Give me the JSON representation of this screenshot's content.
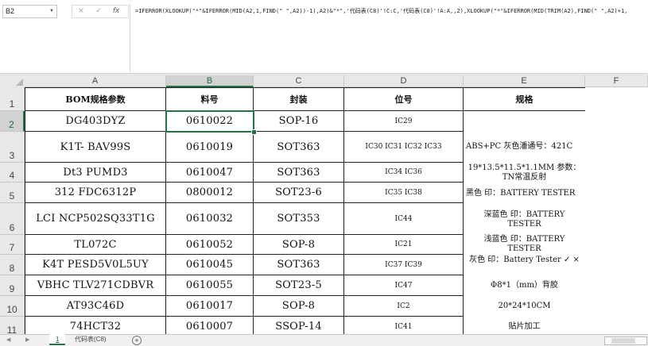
{
  "namebox": "B2",
  "formula_icons": {
    "cancel": "×",
    "confirm": "✓",
    "fx": "fx"
  },
  "formula": "=IFERROR(XLOOKUP(\"*\"&IFERROR(MID(A2,1,FIND(\" \",A2))-1),A2)&\"*\",'代码表(C8)'!C:C,'代码表(C8)'!A:A,,2),XLOOKUP(\"*\"&IFERROR(MID(TRIM(A2),FIND(\" \",A2)+1,",
  "columns": [
    "A",
    "B",
    "C",
    "D",
    "E",
    "F"
  ],
  "rows": [
    "1",
    "2",
    "3",
    "4",
    "5",
    "6",
    "7",
    "8",
    "9",
    "10",
    "11"
  ],
  "header": {
    "bom": "BOM规格参数",
    "part": "料号",
    "package": "封装",
    "position": "位号",
    "spec": "规格"
  },
  "data": [
    {
      "bom": "DG403DYZ",
      "part": "0610022",
      "package": "SOP-16",
      "position": "IC29"
    },
    {
      "bom": "K1T- BAV99S",
      "part": "0610019",
      "package": "SOT363",
      "position": "IC30 IC31 IC32 IC33"
    },
    {
      "bom": "Dt3  PUMD3",
      "part": "0610047",
      "package": "SOT363",
      "position": "IC34 IC36"
    },
    {
      "bom": "312  FDC6312P",
      "part": "0800012",
      "package": "SOT23-6",
      "position": "IC35 IC38"
    },
    {
      "bom": "LCI NCP502SQ33T1G",
      "part": "0610032",
      "package": "SOT353",
      "position": "IC44"
    },
    {
      "bom": "TL072C",
      "part": "0610052",
      "package": "SOP-8",
      "position": "IC21"
    },
    {
      "bom": "K4T  PESD5V0L5UY",
      "part": "0610045",
      "package": "SOT363",
      "position": "IC37 IC39"
    },
    {
      "bom": "VBHC  TLV271CDBVR",
      "part": "0610055",
      "package": "SOT23-5",
      "position": "IC47"
    },
    {
      "bom": "AT93C46D",
      "part": "0610017",
      "package": "SOP-8",
      "position": "IC2"
    },
    {
      "bom": "74HCT32",
      "part": "0610007",
      "package": "SSOP-14",
      "position": "IC41"
    }
  ],
  "spec_texts": [
    "ABS+PC 灰色潘通号：421C",
    "19*13.5*11.5*1.1MM 参数：TN常温反射",
    "黑色 印：BATTERY TESTER",
    "深蓝色 印：BATTERY TESTER",
    "浅蓝色 印：BATTERY TESTER",
    "灰色 印：Battery Tester ✓ ×",
    "Φ8*1（mm）背胶",
    "20*24*10CM",
    "贴片加工"
  ],
  "sheet_tabs": [
    "1",
    "代码表(C8)"
  ],
  "add_sheet": "+",
  "colors": {
    "accent": "#217346",
    "header_bg": "#e8e8e8",
    "selected_header_bg": "#d2d2d2"
  }
}
